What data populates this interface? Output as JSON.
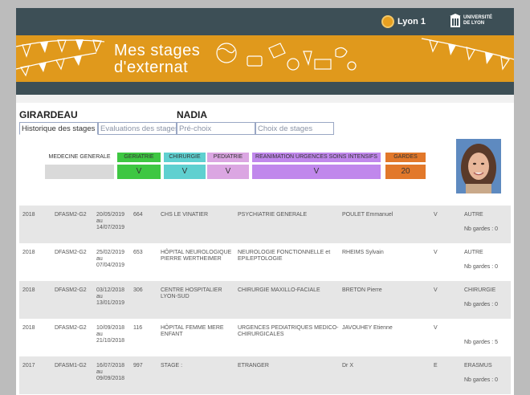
{
  "header": {
    "lyon1_label": "Lyon 1",
    "university_line1": "UNIVERSITÉ",
    "university_line2": "DE LYON",
    "title_line1": "Mes stages",
    "title_line2": "d'externat"
  },
  "student": {
    "last_name": "GIRARDEAU",
    "first_name": "NADIA"
  },
  "tabs": [
    {
      "label": "Historique des stages"
    },
    {
      "label": "Evaluations des stages"
    },
    {
      "label": "Pré-choix"
    },
    {
      "label": "Choix de stages"
    }
  ],
  "stats": [
    {
      "label": "MEDECINE GENERALE",
      "value": "",
      "header_color": "#d9d9d9",
      "value_color": "#d9d9d9"
    },
    {
      "label": "GERIATRIE",
      "value": "V",
      "header_color": "#3ec742",
      "value_color": "#3ec742"
    },
    {
      "label": "CHIRURGIE",
      "value": "V",
      "header_color": "#5fd0d0",
      "value_color": "#5fd0d0"
    },
    {
      "label": "PEDIATRIE",
      "value": "V",
      "header_color": "#dba6e2",
      "value_color": "#dba6e2"
    },
    {
      "label": "REANIMATION URGENCES SOINS INTENSIFS",
      "value": "V",
      "header_color": "#c087ec",
      "value_color": "#c087ec"
    },
    {
      "label": "GARDES",
      "value": "20",
      "header_color": "#e2782a",
      "value_color": "#e2782a"
    }
  ],
  "stages": [
    {
      "year": "2018",
      "level": "DFASM2-G2",
      "date_start": "20/05/2019",
      "date_sep": "au",
      "date_end": "14/07/2019",
      "code": "664",
      "site": "CHS LE VINATIER",
      "service": "PSYCHIATRIE GENERALE",
      "supervisor": "POULET Emmanuel",
      "validation": "V",
      "category": "AUTRE",
      "gardes": "Nb gardes : 0"
    },
    {
      "year": "2018",
      "level": "DFASM2-G2",
      "date_start": "25/02/2019",
      "date_sep": "au",
      "date_end": "07/04/2019",
      "code": "653",
      "site": "HÔPITAL NEUROLOGIQUE PIERRE WERTHEIMER",
      "service": "NEUROLOGIE FONCTIONNELLE et EPILEPTOLOGIE",
      "supervisor": "RHEIMS Sylvain",
      "validation": "V",
      "category": "AUTRE",
      "gardes": "Nb gardes : 0"
    },
    {
      "year": "2018",
      "level": "DFASM2-G2",
      "date_start": "03/12/2018",
      "date_sep": "au",
      "date_end": "13/01/2019",
      "code": "306",
      "site": "CENTRE HOSPITALIER LYON-SUD",
      "service": "CHIRURGIE MAXILLO-FACIALE",
      "supervisor": "BRETON Pierre",
      "validation": "V",
      "category": "CHIRURGIE",
      "gardes": "Nb gardes : 0"
    },
    {
      "year": "2018",
      "level": "DFASM2-G2",
      "date_start": "10/09/2018",
      "date_sep": "au",
      "date_end": "21/10/2018",
      "code": "116",
      "site": "HÔPITAL FEMME MERE ENFANT",
      "service": "URGENCES PEDIATRIQUES MEDICO-CHIRURGICALES",
      "supervisor": "JAVOUHEY Etienne",
      "validation": "V",
      "category": "",
      "gardes": "Nb gardes : 5"
    },
    {
      "year": "2017",
      "level": "DFASM1-G2",
      "date_start": "16/07/2018",
      "date_sep": "au",
      "date_end": "09/09/2018",
      "code": "997",
      "site": "STAGE :",
      "service": "ETRANGER",
      "supervisor": "Dr X",
      "validation": "E",
      "category": "ERASMUS",
      "gardes": "Nb gardes : 0"
    }
  ]
}
